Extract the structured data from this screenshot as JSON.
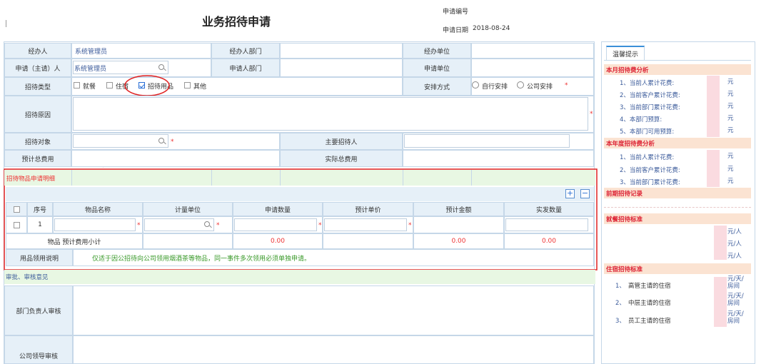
{
  "header": {
    "title": "业务招待申请",
    "app_no_label": "申请编号",
    "app_date_label": "申请日期",
    "app_date_value": "2018-08-24"
  },
  "form": {
    "handler_label": "经办人",
    "handler_value": "系统管理员",
    "handler_dept_label": "经办人部门",
    "handler_unit_label": "经办单位",
    "applicant_label": "申请（主请）人",
    "applicant_value": "系统管理员",
    "applicant_dept_label": "申请人部门",
    "applicant_unit_label": "申请单位",
    "type_label": "招待类型",
    "type_options": [
      "就餐",
      "住宿",
      "招待用品",
      "其他"
    ],
    "arrange_label": "安排方式",
    "arrange_options": [
      "自行安排",
      "公司安排"
    ],
    "reason_label": "招待原因",
    "target_label": "招待对象",
    "main_host_label": "主要招待人",
    "est_total_label": "预计总费用",
    "actual_total_label": "实际总费用"
  },
  "detail": {
    "section_title": "招待物品申请明细",
    "columns": [
      "序号",
      "物品名称",
      "计量单位",
      "申请数量",
      "预计单价",
      "预计金额",
      "实发数量"
    ],
    "row_no": "1",
    "subtotal_label": "物品 预计费用小计",
    "subtotal_qty": "0.00",
    "subtotal_amount": "0.00",
    "subtotal_issued": "0.00",
    "usage_label": "用品领用说明",
    "usage_text": "仅适于因公招待向公司领用烟酒茶等物品，同一事件多次领用必须单独申请。",
    "add_symbol": "+",
    "remove_symbol": "−"
  },
  "approval": {
    "section_title": "审批、审核意见",
    "dept_head_label": "部门负责人审核",
    "company_leader_label": "公司领导审核"
  },
  "tips": {
    "tab_label": "温馨提示",
    "monthly_title": "本月招待费分析",
    "monthly_items": [
      "1、当前人累计花费:",
      "2、当前客户累计花费:",
      "3、当前部门累计花费:",
      "4、本部门预算:",
      "5、本部门可用预算:"
    ],
    "yearly_title": "本年度招待费分析",
    "yearly_items": [
      "1、当前人累计花费:",
      "2、当前客户累计花费:",
      "3、当前部门累计花费:"
    ],
    "history_title": "前期招待记录",
    "meal_title": "就餐招待标准",
    "meal_unit": "元/人",
    "lodging_title": "住宿招待标准",
    "lodging_items": [
      "1、",
      "2、",
      "3、"
    ],
    "lodging_names": [
      "高管主请的住宿",
      "中层主请的住宿",
      "员工主请的住宿"
    ],
    "lodging_unit_1": "元/天/",
    "lodging_unit_2": "房间",
    "currency": "元"
  },
  "colors": {
    "accent": "#2a6fd6",
    "required": "#ee3333",
    "highlight_red": "#e02020",
    "label_bg": "#e6f0f8",
    "section_bg": "#fbe3d2"
  }
}
